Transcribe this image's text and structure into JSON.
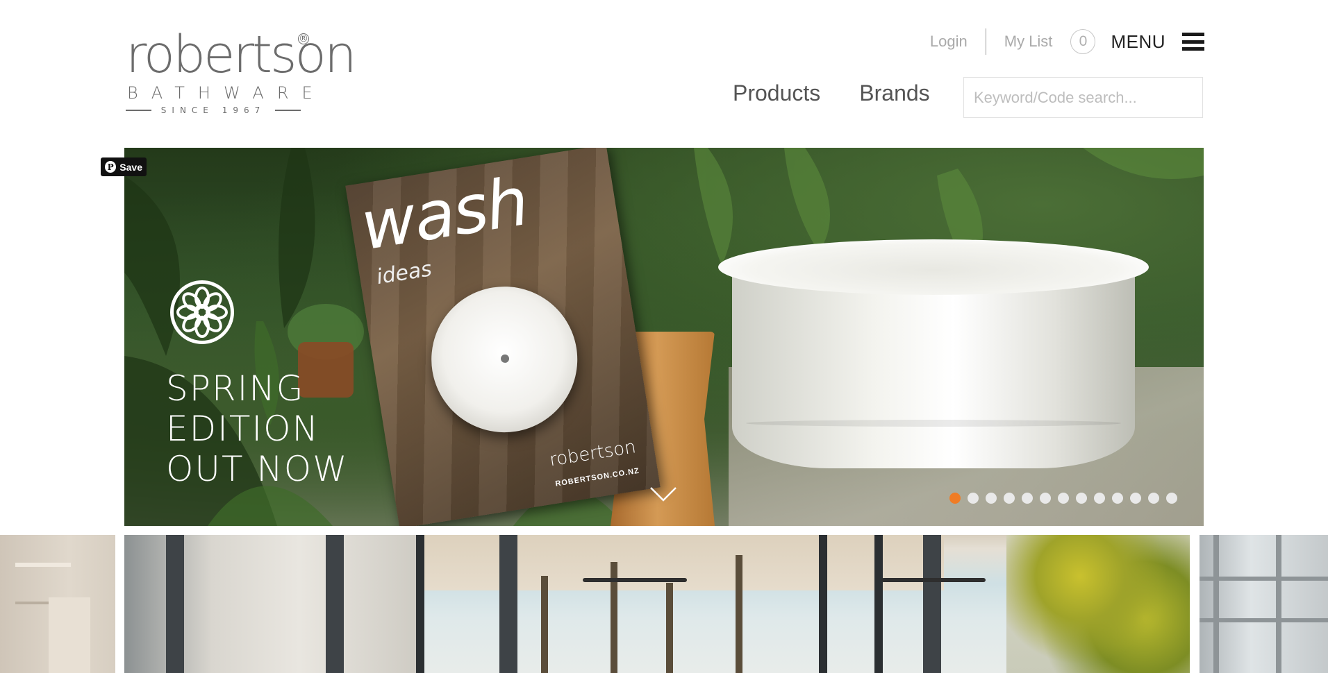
{
  "logo": {
    "wordmark": "robertson",
    "registered": "®",
    "subtitle": "BATHWARE",
    "since": "SINCE 1967"
  },
  "header": {
    "login": "Login",
    "my_list": "My List",
    "list_count": "0",
    "menu_label": "MENU"
  },
  "nav": {
    "items": [
      {
        "label": "Products"
      },
      {
        "label": "Brands"
      }
    ]
  },
  "search": {
    "placeholder": "Keyword/Code search...",
    "value": ""
  },
  "hero": {
    "pin_save": "Save",
    "promo_lines": [
      "SPRING",
      "EDITION",
      "OUT NOW"
    ],
    "magazine": {
      "title": "wash",
      "subtitle": "ideas",
      "brand": "robertson",
      "url": "ROBERTSON.CO.NZ"
    },
    "slides_total": 13,
    "active_slide": 1
  },
  "colors": {
    "accent": "#f07c25",
    "logo_grey": "#6c6c6c",
    "nav_text": "#545454"
  },
  "icons": {
    "menu": "hamburger-icon",
    "pin": "pinterest-icon",
    "scroll": "chevron-down-icon",
    "badge": "flower-icon"
  }
}
